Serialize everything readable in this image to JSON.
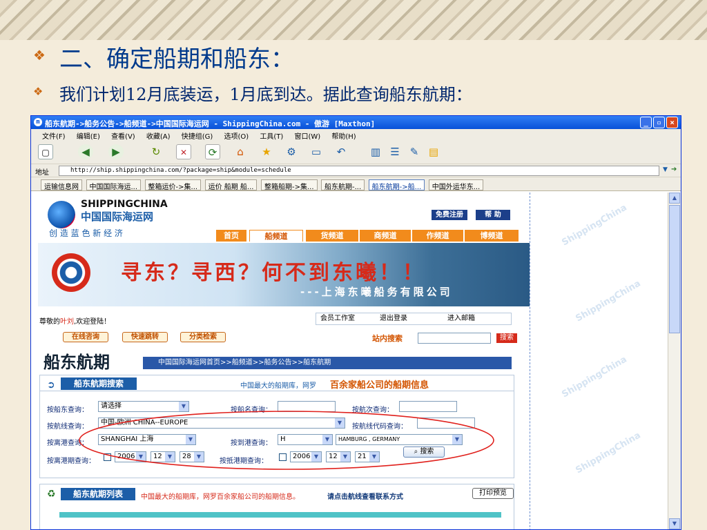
{
  "slide": {
    "title": "二、确定船期和船东：",
    "subtitle": "我们计划12月底装运，1月底到达。据此查询船东航期：",
    "bullet": "❖"
  },
  "browser": {
    "title": "船东航期->船务公告->船频道->中国国际海运网 - ShippingChina.com - 傲游 [Maxthon]",
    "menu": [
      "文件(F)",
      "编辑(E)",
      "查看(V)",
      "收藏(A)",
      "快捷组(G)",
      "选项(O)",
      "工具(T)",
      "窗口(W)",
      "帮助(H)"
    ],
    "address_label": "地址",
    "address": "http://ship.shippingchina.com/?package=ship&module=schedule",
    "tabs": [
      "运输信息网",
      "中国国际海运...",
      "整箱运价->集...",
      "运价 船期 船...",
      "整箱船期->集...",
      "船东航期-...",
      "船东航期->船...",
      "中国外运华东..."
    ]
  },
  "site": {
    "logo_en": "SHIPPINGCHINA",
    "logo_cn": "中国国际海运网",
    "slogan": "创 造 蓝 色 新 经 济",
    "register": "免费注册",
    "help": "帮  助",
    "nav": [
      "首页",
      "船频道",
      "货频道",
      "商频道",
      "作频道",
      "博频道"
    ],
    "banner_main": "寻东？寻西？何不到东曦！！",
    "banner_sub": "---上海东曦船务有限公司",
    "welcome_prefix": "尊敬的",
    "welcome_user": "叶刘",
    "welcome_suffix": ",欢迎登陆！",
    "member_links": [
      "会员工作室",
      "退出登录",
      "进入邮箱"
    ],
    "quick_buttons": [
      "在线咨询",
      "快速跳转",
      "分类检索"
    ],
    "site_search_label": "站内搜索",
    "search_button": "搜索",
    "page_heading": "船东航期",
    "breadcrumb": "中国国际海运网首页>>船频道>>船务公告>>船东航期"
  },
  "search_panel": {
    "title": "船东航期搜索",
    "tagline_small": "中国最大的船期库，网罗",
    "tagline_big": "百余家船公司的船期信息",
    "owner_label": "按船东查询：",
    "owner_value": "请选择",
    "vessel_label": "按船名查询：",
    "voyage_label": "按航次查询：",
    "route_label": "按航线查询：",
    "route_value": "中国-欧洲 CHINA--EUROPE",
    "route_code_label": "按航线代码查询：",
    "dep_port_label": "按离港查询：",
    "dep_port_value": "SHANGHAI 上海",
    "arr_port_label": "按到港查询：",
    "arr_letter": "H",
    "arr_port_value": "HAMBURG , GERMANY",
    "dep_date_label": "按离港期查询：",
    "dep_date": {
      "year": "2006",
      "month": "12",
      "day": "28"
    },
    "arr_date_label": "按抵港期查询：",
    "arr_date": {
      "year": "2006",
      "month": "12",
      "day": "21"
    },
    "search_button": "搜索"
  },
  "list_panel": {
    "title": "船东航期列表",
    "note": "中国最大的船期库，网罗百余家船公司的船期信息。",
    "hint": "请点击航线查看联系方式",
    "print": "打印预览"
  },
  "colors": {
    "slide_title": "#003a8c",
    "accent": "#f28b1c",
    "annotation_circle": "#e0201c"
  },
  "icons": [
    "browser-icon",
    "new-page-icon",
    "back-icon",
    "forward-icon",
    "refresh-icon",
    "stop-icon",
    "home-icon",
    "favorites-icon",
    "go-icon"
  ]
}
